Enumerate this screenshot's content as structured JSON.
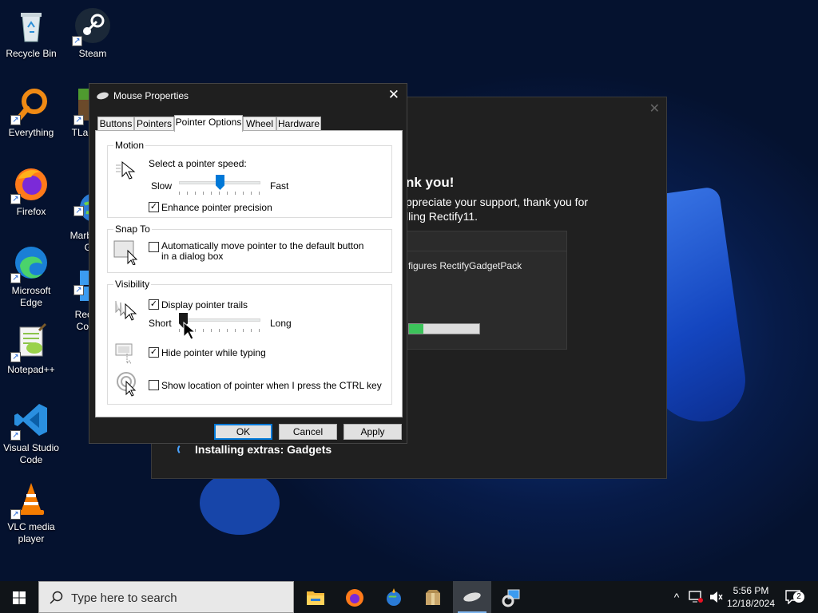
{
  "desktop": {
    "icons": [
      {
        "label": "Recycle Bin"
      },
      {
        "label": "Steam"
      },
      {
        "label": "Everything"
      },
      {
        "label": "TLau"
      },
      {
        "label": "Firefox"
      },
      {
        "label": "Marb\nG"
      },
      {
        "label": "Microsoft Edge"
      },
      {
        "label": "Rec\nCor"
      },
      {
        "label": "Notepad++"
      },
      {
        "label": "Visual Studio Code"
      },
      {
        "label": "VLC media player"
      }
    ]
  },
  "installer": {
    "heading": "nk you!",
    "line1": "ppreciate your support, thank you for",
    "line2": "lling Rectify11.",
    "panel_text": "figures RectifyGadgetPack",
    "progress": 0.2,
    "status": "Installing extras: Gadgets"
  },
  "dialog": {
    "title": "Mouse Properties",
    "tabs": [
      "Buttons",
      "Pointers",
      "Pointer Options",
      "Wheel",
      "Hardware"
    ],
    "active_tab": "Pointer Options",
    "motion": {
      "group": "Motion",
      "prompt": "Select a pointer speed:",
      "slow": "Slow",
      "fast": "Fast",
      "speed": 0.5,
      "precision_label": "Enhance pointer precision",
      "precision_checked": true
    },
    "snap": {
      "group": "Snap To",
      "label": "Automatically move pointer to the default button in a dialog box",
      "checked": false
    },
    "visibility": {
      "group": "Visibility",
      "trails_label": "Display pointer trails",
      "trails_checked": true,
      "short": "Short",
      "long": "Long",
      "trail_length": 0.0,
      "hide_label": "Hide pointer while typing",
      "hide_checked": true,
      "ctrl_label": "Show location of pointer when I press the CTRL key",
      "ctrl_checked": false
    },
    "buttons": {
      "ok": "OK",
      "cancel": "Cancel",
      "apply": "Apply"
    }
  },
  "taskbar": {
    "search_placeholder": "Type here to search",
    "time": "5:56 PM",
    "date": "12/18/2024",
    "notifications": "2"
  }
}
